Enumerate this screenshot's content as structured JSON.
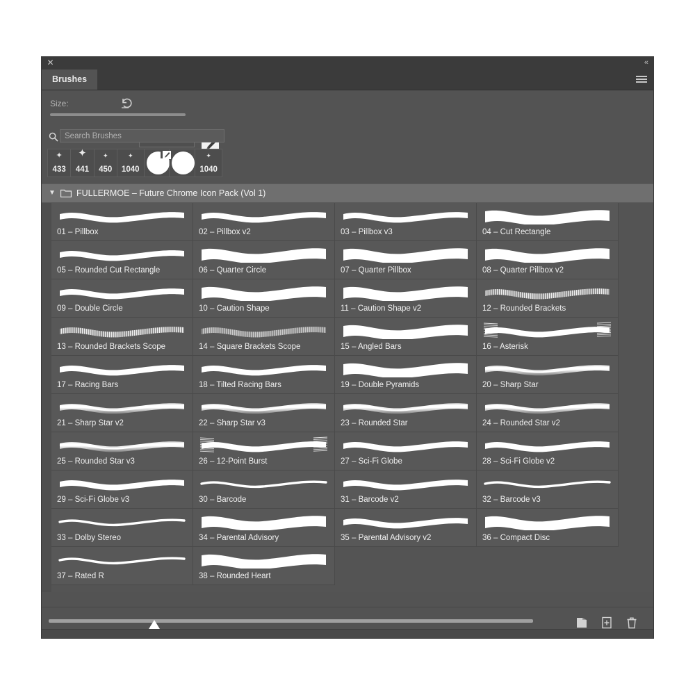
{
  "window": {
    "title": "Brushes",
    "close_icon": "close-icon",
    "collapse_icon": "double-chevron-left-icon",
    "menu_icon": "hamburger-menu-icon"
  },
  "size_row": {
    "label": "Size:",
    "reset_icon": "reset-arrow-icon",
    "value": "",
    "brush_folder_icon": "brush-folder-icon",
    "slider_name": "size-slider"
  },
  "search": {
    "placeholder": "Search Brushes",
    "value": "",
    "icon": "search-icon"
  },
  "presets": [
    {
      "glyph": "sparkle",
      "label": "433"
    },
    {
      "glyph": "sparkle",
      "label": "441"
    },
    {
      "glyph": "sparkle",
      "label": "450"
    },
    {
      "glyph": "sparkle",
      "label": "1040"
    },
    {
      "glyph": "circle-cut",
      "label": ""
    },
    {
      "glyph": "circle",
      "label": ""
    },
    {
      "glyph": "sparkle",
      "label": "1040"
    }
  ],
  "group": {
    "title": "FULLERMOE – Future Chrome Icon Pack (Vol 1)",
    "expanded": true,
    "twisty_icon": "chevron-down-icon",
    "folder_icon": "folder-icon"
  },
  "brushes": [
    {
      "label": "01 – Pillbox",
      "style": "solid"
    },
    {
      "label": "02 – Pillbox v2",
      "style": "solid"
    },
    {
      "label": "03 – Pillbox v3",
      "style": "solid"
    },
    {
      "label": "04 – Cut Rectangle",
      "style": "thick"
    },
    {
      "label": "05 – Rounded Cut Rectangle",
      "style": "solid"
    },
    {
      "label": "06 – Quarter Circle",
      "style": "thick"
    },
    {
      "label": "07 – Quarter Pillbox",
      "style": "thick"
    },
    {
      "label": "08 – Quarter Pillbox v2",
      "style": "thick"
    },
    {
      "label": "09 – Double Circle",
      "style": "solid"
    },
    {
      "label": "10 – Caution Shape",
      "style": "thick"
    },
    {
      "label": "11 – Caution Shape v2",
      "style": "thick"
    },
    {
      "label": "12 – Rounded Brackets",
      "style": "striped"
    },
    {
      "label": "13 – Rounded Brackets Scope",
      "style": "striped"
    },
    {
      "label": "14 – Square Brackets Scope",
      "style": "striped-light"
    },
    {
      "label": "15 – Angled Bars",
      "style": "thick"
    },
    {
      "label": "16 – Asterisk",
      "style": "frayed"
    },
    {
      "label": "17 – Racing Bars",
      "style": "solid"
    },
    {
      "label": "18 – Tilted Racing Bars",
      "style": "solid"
    },
    {
      "label": "19 – Double Pyramids",
      "style": "thick"
    },
    {
      "label": "20 – Sharp Star",
      "style": "glow"
    },
    {
      "label": "21 – Sharp Star v2",
      "style": "glow"
    },
    {
      "label": "22 – Sharp Star v3",
      "style": "glow"
    },
    {
      "label": "23 – Rounded Star",
      "style": "glow"
    },
    {
      "label": "24 – Rounded Star v2",
      "style": "glow"
    },
    {
      "label": "25 – Rounded Star v3",
      "style": "glow"
    },
    {
      "label": "26 – 12-Point Burst",
      "style": "frayed"
    },
    {
      "label": "27 – Sci-Fi Globe",
      "style": "solid"
    },
    {
      "label": "28 – Sci-Fi Globe v2",
      "style": "solid"
    },
    {
      "label": "29 – Sci-Fi Globe v3",
      "style": "solid"
    },
    {
      "label": "30 – Barcode",
      "style": "thin"
    },
    {
      "label": "31 – Barcode v2",
      "style": "solid"
    },
    {
      "label": "32 – Barcode v3",
      "style": "thin"
    },
    {
      "label": "33 – Dolby Stereo",
      "style": "thin"
    },
    {
      "label": "34 – Parental Advisory",
      "style": "thick"
    },
    {
      "label": "35 – Parental Advisory v2",
      "style": "solid"
    },
    {
      "label": "36 – Compact Disc",
      "style": "thick"
    },
    {
      "label": "37 – Rated R",
      "style": "thin"
    },
    {
      "label": "38 – Rounded Heart",
      "style": "thick"
    }
  ],
  "bottom_bar": {
    "slider_name": "brush-size-slider",
    "new_folder_icon": "new-folder-icon",
    "new_brush_icon": "new-brush-icon",
    "delete_icon": "trash-icon"
  },
  "colors": {
    "panel_bg": "#535353",
    "cell_bg": "#585858",
    "group_header_bg": "#6f6f6f",
    "titlebar_bg": "#3b3b3b",
    "text": "#f0f0f0",
    "stroke_white": "#ffffff"
  }
}
